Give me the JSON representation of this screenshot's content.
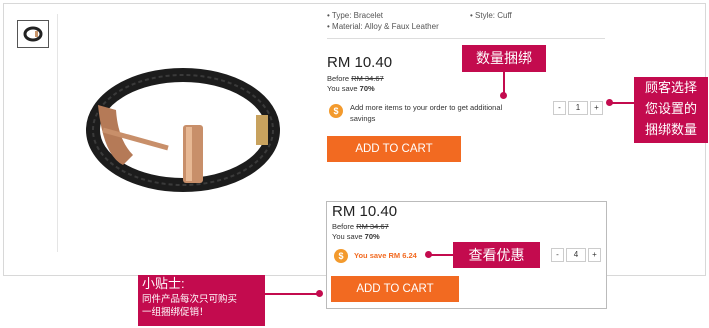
{
  "specs": {
    "type": "• Type: Bracelet",
    "material": "• Material: Alloy & Faux Leather",
    "style": "• Style: Cuff"
  },
  "offer1": {
    "price": "RM 10.40",
    "before_label": "Before ",
    "before_value": "RM 34.67",
    "save_label": "You save ",
    "save_value": "70%",
    "coin": "$",
    "note_line1": "Add more items to your order to get additional",
    "note_line2": "savings",
    "qty_minus": "-",
    "qty_value": "1",
    "qty_plus": "+",
    "button": "ADD TO CART"
  },
  "offer2": {
    "price": "RM 10.40",
    "before_label": "Before ",
    "before_value": "RM 34.67",
    "save_label": "You save ",
    "save_value": "70%",
    "coin": "$",
    "note": "You save RM 6.24",
    "qty_minus": "-",
    "qty_value": "4",
    "qty_plus": "+",
    "button": "ADD TO CART"
  },
  "callouts": {
    "bundle": "数量捆绑",
    "customer_line1": "顾客选择",
    "customer_line2": "您设置的",
    "customer_line3": "捆绑数量",
    "view": "查看优惠",
    "tip_title": "小贴士:",
    "tip_line1": "同件产品每次只可购买",
    "tip_line2": "一组捆绑促销！"
  },
  "colors": {
    "accent": "#f26a21",
    "callout": "#c30b4e",
    "coin": "#f39a2d"
  }
}
